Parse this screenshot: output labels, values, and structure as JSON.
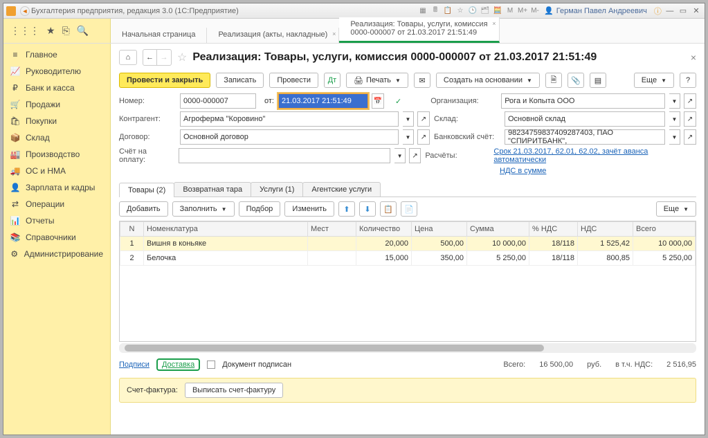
{
  "app": {
    "title": "Бухгалтерия предприятия, редакция 3.0  (1С:Предприятие)",
    "user": "Герман Павел Андреевич"
  },
  "tb_icons": {
    "m": "M",
    "mplus": "M+",
    "mminus": "M-"
  },
  "doctabs": {
    "t0": "Начальная страница",
    "t1": "Реализация (акты, накладные)",
    "t2a": "Реализация: Товары, услуги, комиссия",
    "t2b": "0000-000007 от 21.03.2017 21:51:49"
  },
  "sidebar": [
    {
      "icon": "≡",
      "label": "Главное"
    },
    {
      "icon": "📈",
      "label": "Руководителю"
    },
    {
      "icon": "₽",
      "label": "Банк и касса"
    },
    {
      "icon": "🛒",
      "label": "Продажи"
    },
    {
      "icon": "🛍",
      "label": "Покупки"
    },
    {
      "icon": "📦",
      "label": "Склад"
    },
    {
      "icon": "🏭",
      "label": "Производство"
    },
    {
      "icon": "🚚",
      "label": "ОС и НМА"
    },
    {
      "icon": "👤",
      "label": "Зарплата и кадры"
    },
    {
      "icon": "⇄",
      "label": "Операции"
    },
    {
      "icon": "📊",
      "label": "Отчеты"
    },
    {
      "icon": "📚",
      "label": "Справочники"
    },
    {
      "icon": "⚙",
      "label": "Администрирование"
    }
  ],
  "doc": {
    "title": "Реализация: Товары, услуги, комиссия 0000-000007 от 21.03.2017 21:51:49",
    "actions": {
      "post_close": "Провести и закрыть",
      "write": "Записать",
      "post": "Провести",
      "print": "Печать",
      "create_based": "Создать на основании",
      "more": "Еще",
      "help": "?"
    },
    "fields": {
      "num_lbl": "Номер:",
      "num": "0000-000007",
      "from_lbl": "от:",
      "date": "21.03.2017 21:51:49",
      "org_lbl": "Организация:",
      "org": "Рога и Копыта ООО",
      "contr_lbl": "Контрагент:",
      "contr": "Агроферма \"Коровино\"",
      "wh_lbl": "Склад:",
      "wh": "Основной склад",
      "dogovor_lbl": "Договор:",
      "dogovor": "Основной договор",
      "bank_lbl": "Банковский счёт:",
      "bank": "98234759837409287403, ПАО \"СПИРИТБАНК\",",
      "acct_lbl": "Счёт на оплату:",
      "acct": "",
      "calc_lbl": "Расчёты:",
      "calc_link": "Срок 21.03.2017, 62.01, 62.02, зачёт аванса автоматически",
      "nds_link": "НДС в сумме"
    },
    "subtabs": {
      "t0": "Товары (2)",
      "t1": "Возвратная тара",
      "t2": "Услуги (1)",
      "t3": "Агентские услуги"
    },
    "tblbtns": {
      "add": "Добавить",
      "fill": "Заполнить",
      "pick": "Подбор",
      "edit": "Изменить",
      "more": "Еще"
    },
    "cols": {
      "n": "N",
      "nom": "Номенклатура",
      "mest": "Мест",
      "qty": "Количество",
      "price": "Цена",
      "sum": "Сумма",
      "ndsp": "% НДС",
      "nds": "НДС",
      "total": "Всего"
    },
    "rows": [
      {
        "n": "1",
        "nom": "Вишня в коньяке",
        "mest": "",
        "qty": "20,000",
        "price": "500,00",
        "sum": "10 000,00",
        "ndsp": "18/118",
        "nds": "1 525,42",
        "total": "10 000,00"
      },
      {
        "n": "2",
        "nom": "Белочка",
        "mest": "",
        "qty": "15,000",
        "price": "350,00",
        "sum": "5 250,00",
        "ndsp": "18/118",
        "nds": "800,85",
        "total": "5 250,00"
      }
    ],
    "footer": {
      "signs": "Подписи",
      "delivery": "Доставка",
      "signed": "Документ подписан",
      "total_lbl": "Всего:",
      "total": "16 500,00",
      "rub": "руб.",
      "vat_lbl": "в т.ч. НДС:",
      "vat": "2 516,95",
      "sf_lbl": "Счет-фактура:",
      "sf_btn": "Выписать счет-фактуру"
    }
  }
}
